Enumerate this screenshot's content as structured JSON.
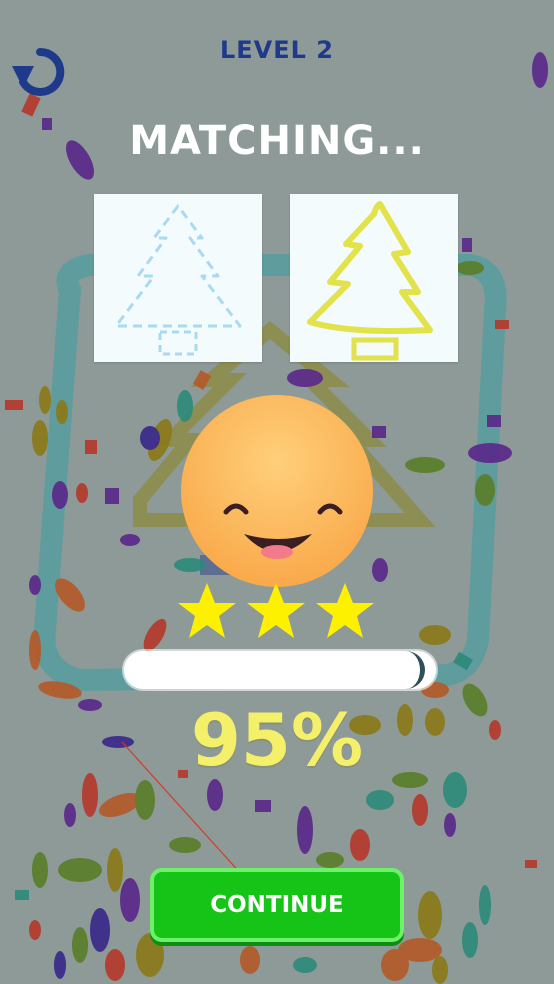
{
  "header": {
    "level": "LEVEL 2",
    "restart_icon": "restart-icon"
  },
  "result": {
    "heading": "MATCHING...",
    "percent_text": "95%",
    "match_fraction": 0.95,
    "stars_earned": 3,
    "stars_total": 3
  },
  "cards": {
    "target_icon": "christmas-tree-outline-icon",
    "drawn_icon": "christmas-tree-drawing-icon"
  },
  "actions": {
    "continue_label": "CONTINUE"
  },
  "colors": {
    "background": "#8f9a98",
    "level_text": "#1f3a8a",
    "star": "#fdf100",
    "percent_text": "#f5f06a",
    "continue_button": "#15c416",
    "drawing_stroke": "#e2e24a",
    "dashed_outline": "#a9daf0"
  }
}
